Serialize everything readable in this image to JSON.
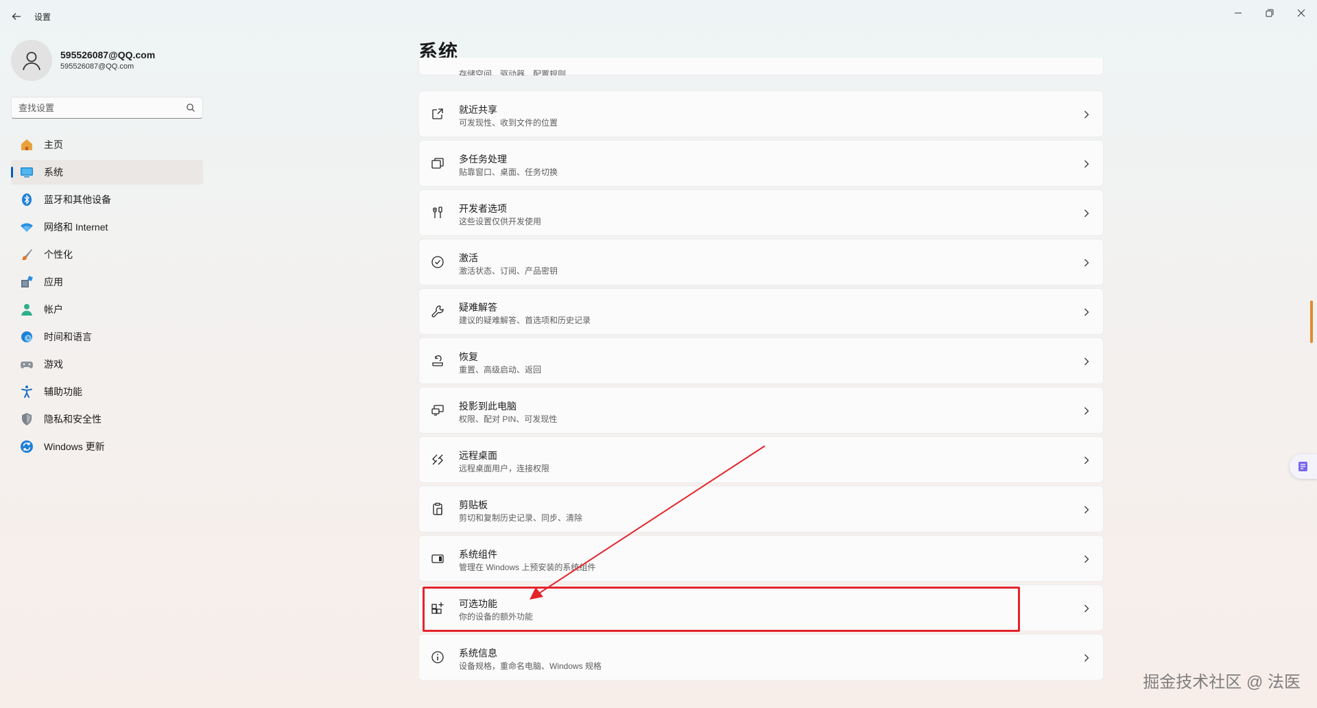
{
  "window": {
    "title": "设置",
    "controls": {
      "minimize": "─",
      "maximize": "❐",
      "close": "✕"
    }
  },
  "user": {
    "name": "595526087@QQ.com",
    "email": "595526087@QQ.com"
  },
  "search": {
    "placeholder": "查找设置"
  },
  "sidebar": {
    "items": [
      {
        "label": "主页",
        "icon": "home-icon"
      },
      {
        "label": "系统",
        "icon": "system-monitor-icon",
        "active": true
      },
      {
        "label": "蓝牙和其他设备",
        "icon": "bluetooth-icon"
      },
      {
        "label": "网络和 Internet",
        "icon": "wifi-icon"
      },
      {
        "label": "个性化",
        "icon": "brush-icon"
      },
      {
        "label": "应用",
        "icon": "apps-icon"
      },
      {
        "label": "帐户",
        "icon": "account-icon"
      },
      {
        "label": "时间和语言",
        "icon": "globe-clock-icon"
      },
      {
        "label": "游戏",
        "icon": "gamepad-icon"
      },
      {
        "label": "辅助功能",
        "icon": "accessibility-icon"
      },
      {
        "label": "隐私和安全性",
        "icon": "shield-icon"
      },
      {
        "label": "Windows 更新",
        "icon": "update-icon"
      }
    ]
  },
  "main": {
    "title": "系统",
    "partial_item": {
      "subtitle": "存储空间、驱动器、配置规则"
    },
    "items": [
      {
        "title": "就近共享",
        "subtitle": "可发现性、收到文件的位置",
        "icon": "share-icon"
      },
      {
        "title": "多任务处理",
        "subtitle": "贴靠窗口、桌面、任务切换",
        "icon": "multitask-icon"
      },
      {
        "title": "开发者选项",
        "subtitle": "这些设置仅供开发使用",
        "icon": "developer-tools-icon"
      },
      {
        "title": "激活",
        "subtitle": "激活状态、订阅、产品密钥",
        "icon": "check-circle-icon"
      },
      {
        "title": "疑难解答",
        "subtitle": "建议的疑难解答、首选项和历史记录",
        "icon": "wrench-icon"
      },
      {
        "title": "恢复",
        "subtitle": "重置、高级启动、返回",
        "icon": "recovery-icon"
      },
      {
        "title": "投影到此电脑",
        "subtitle": "权限、配对 PIN、可发现性",
        "icon": "project-icon"
      },
      {
        "title": "远程桌面",
        "subtitle": "远程桌面用户，连接权限",
        "icon": "remote-desktop-icon"
      },
      {
        "title": "剪贴板",
        "subtitle": "剪切和复制历史记录、同步、清除",
        "icon": "clipboard-icon"
      },
      {
        "title": "系统组件",
        "subtitle": "管理在 Windows 上预安装的系统组件",
        "icon": "components-icon"
      },
      {
        "title": "可选功能",
        "subtitle": "你的设备的额外功能",
        "icon": "optional-features-icon",
        "highlighted": true
      },
      {
        "title": "系统信息",
        "subtitle": "设备规格，重命名电脑、Windows 规格",
        "icon": "info-icon"
      }
    ]
  },
  "annotation": {
    "color": "#e3242b"
  },
  "watermark": "掘金技术社区 @ 法医",
  "colors": {
    "accent": "#005fb8",
    "scroll_thumb": "#e58a2e"
  }
}
